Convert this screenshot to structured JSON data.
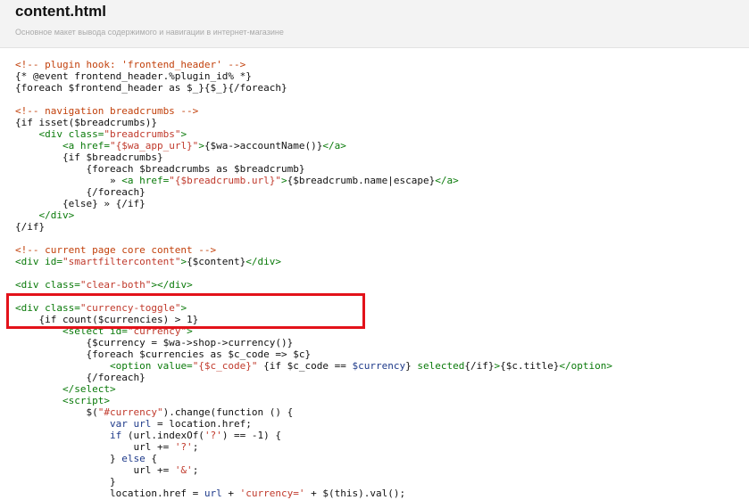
{
  "file": {
    "title": "content.html",
    "description": "Основное макет вывода содержимого и навигации в интернет-магазине"
  },
  "colors": {
    "highlight_border": "#e3121a",
    "comment": "#c2410c",
    "string": "#c0392b",
    "tag": "#0a7a0a",
    "variable": "#1e3a8a"
  },
  "code": {
    "lines": [
      [
        [
          "comment",
          "<!-- plugin hook: 'frontend_header' -->"
        ]
      ],
      [
        [
          "plain",
          "{* @event frontend_header.%plugin_id% *}"
        ]
      ],
      [
        [
          "plain",
          "{foreach $frontend_header as $_}{$_}{/foreach}"
        ]
      ],
      [],
      [
        [
          "comment",
          "<!-- navigation breadcrumbs -->"
        ]
      ],
      [
        [
          "plain",
          "{if isset($breadcrumbs)}"
        ]
      ],
      [
        [
          "plain",
          "    "
        ],
        [
          "tag",
          "<div class="
        ],
        [
          "string",
          "\"breadcrumbs\""
        ],
        [
          "tag",
          ">"
        ]
      ],
      [
        [
          "plain",
          "        "
        ],
        [
          "tag",
          "<a href="
        ],
        [
          "string",
          "\"{$wa_app_url}\""
        ],
        [
          "tag",
          ">"
        ],
        [
          "plain",
          "{$wa->accountName()}"
        ],
        [
          "tag",
          "</a>"
        ]
      ],
      [
        [
          "plain",
          "        {if $breadcrumbs}"
        ]
      ],
      [
        [
          "plain",
          "            {foreach $breadcrumbs as $breadcrumb}"
        ]
      ],
      [
        [
          "plain",
          "                » "
        ],
        [
          "tag",
          "<a href="
        ],
        [
          "string",
          "\"{$breadcrumb.url}\""
        ],
        [
          "tag",
          ">"
        ],
        [
          "plain",
          "{$breadcrumb.name|escape}"
        ],
        [
          "tag",
          "</a>"
        ]
      ],
      [
        [
          "plain",
          "            {/foreach}"
        ]
      ],
      [
        [
          "plain",
          "        {else} » {/if}"
        ]
      ],
      [
        [
          "plain",
          "    "
        ],
        [
          "tag",
          "</div>"
        ]
      ],
      [
        [
          "plain",
          "{/if}"
        ]
      ],
      [],
      [
        [
          "comment",
          "<!-- current page core content -->"
        ]
      ],
      [
        [
          "tag",
          "<div id="
        ],
        [
          "string",
          "\"smartfiltercontent\""
        ],
        [
          "tag",
          ">"
        ],
        [
          "plain",
          "{$content}"
        ],
        [
          "tag",
          "</div>"
        ]
      ],
      [],
      [
        [
          "tag",
          "<div class="
        ],
        [
          "string",
          "\"clear-both\""
        ],
        [
          "tag",
          "></div>"
        ]
      ],
      [],
      [
        [
          "tag",
          "<div class="
        ],
        [
          "string",
          "\"currency-toggle\""
        ],
        [
          "tag",
          ">"
        ]
      ],
      [
        [
          "plain",
          "    {if count($currencies) > 1}"
        ]
      ],
      [
        [
          "plain",
          "        "
        ],
        [
          "tag",
          "<select id="
        ],
        [
          "string",
          "\"currency\""
        ],
        [
          "tag",
          ">"
        ]
      ],
      [
        [
          "plain",
          "            {$currency = $wa->shop->currency()}"
        ]
      ],
      [
        [
          "plain",
          "            {foreach $currencies as $c_code => $c}"
        ]
      ],
      [
        [
          "plain",
          "                "
        ],
        [
          "tag",
          "<option value="
        ],
        [
          "string",
          "\"{$c_code}\""
        ],
        [
          "plain",
          " {if $c_code == "
        ],
        [
          "var",
          "$currency"
        ],
        [
          "plain",
          "} "
        ],
        [
          "tag",
          "selected"
        ],
        [
          "plain",
          "{/if}"
        ],
        [
          "tag",
          ">"
        ],
        [
          "plain",
          "{$c.title}"
        ],
        [
          "tag",
          "</option>"
        ]
      ],
      [
        [
          "plain",
          "            {/foreach}"
        ]
      ],
      [
        [
          "plain",
          "        "
        ],
        [
          "tag",
          "</select>"
        ]
      ],
      [
        [
          "plain",
          "        "
        ],
        [
          "tag",
          "<script>"
        ]
      ],
      [
        [
          "plain",
          "            $("
        ],
        [
          "string",
          "\"#currency\""
        ],
        [
          "plain",
          ").change(function () {"
        ]
      ],
      [
        [
          "plain",
          "                "
        ],
        [
          "var",
          "var url"
        ],
        [
          "plain",
          " = location.href;"
        ]
      ],
      [
        [
          "plain",
          "                "
        ],
        [
          "var",
          "if"
        ],
        [
          "plain",
          " (url.indexOf("
        ],
        [
          "string",
          "'?'"
        ],
        [
          "plain",
          ") == -1) {"
        ]
      ],
      [
        [
          "plain",
          "                    url += "
        ],
        [
          "string",
          "'?'"
        ],
        [
          "plain",
          ";"
        ]
      ],
      [
        [
          "plain",
          "                } "
        ],
        [
          "var",
          "else"
        ],
        [
          "plain",
          " {"
        ]
      ],
      [
        [
          "plain",
          "                    url += "
        ],
        [
          "string",
          "'&'"
        ],
        [
          "plain",
          ";"
        ]
      ],
      [
        [
          "plain",
          "                }"
        ]
      ],
      [
        [
          "plain",
          "                location.href = "
        ],
        [
          "var",
          "url"
        ],
        [
          "plain",
          " + "
        ],
        [
          "string",
          "'currency='"
        ],
        [
          "plain",
          " + $(this).val();"
        ]
      ]
    ]
  }
}
